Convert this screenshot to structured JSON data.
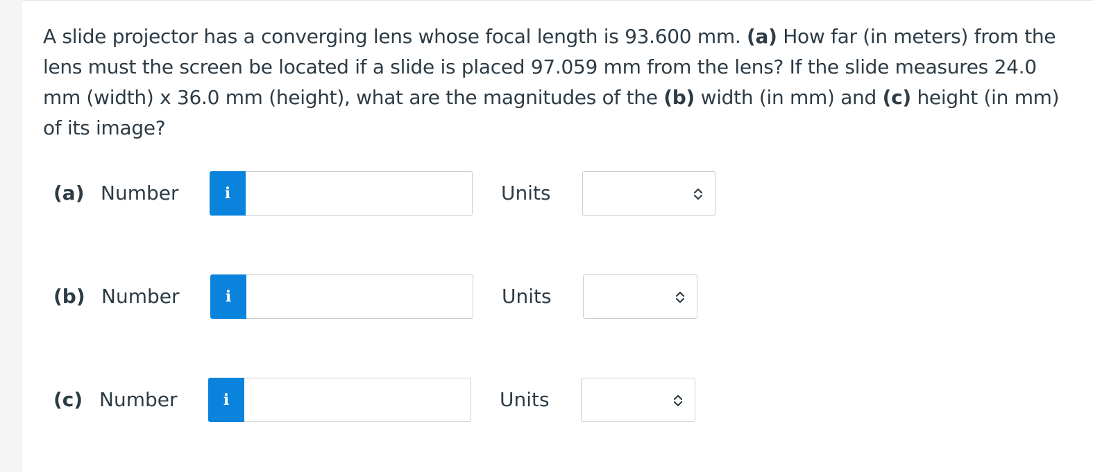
{
  "question": {
    "parts": [
      {
        "text": "A slide projector has a converging lens whose focal length is 93.600 mm. ",
        "bold": false
      },
      {
        "text": "(a)",
        "bold": true
      },
      {
        "text": " How far (in meters) from the lens must the screen be located if a slide is placed 97.059 mm from the lens? If the slide measures 24.0 mm (width) x 36.0 mm (height), what are the magnitudes of the ",
        "bold": false
      },
      {
        "text": "(b)",
        "bold": true
      },
      {
        "text": " width (in mm) and ",
        "bold": false
      },
      {
        "text": "(c)",
        "bold": true
      },
      {
        "text": " height (in mm) of its image?",
        "bold": false
      }
    ]
  },
  "answers": [
    {
      "part": "(a)",
      "number_label": "Number",
      "info_icon": "i",
      "number_value": "",
      "units_label": "Units",
      "units_value": ""
    },
    {
      "part": "(b)",
      "number_label": "Number",
      "info_icon": "i",
      "number_value": "",
      "units_label": "Units",
      "units_value": ""
    },
    {
      "part": "(c)",
      "number_label": "Number",
      "info_icon": "i",
      "number_value": "",
      "units_label": "Units",
      "units_value": ""
    }
  ],
  "colors": {
    "info_button": "#0a83dd",
    "text": "#2d3b45",
    "border": "#c7cdd1"
  }
}
